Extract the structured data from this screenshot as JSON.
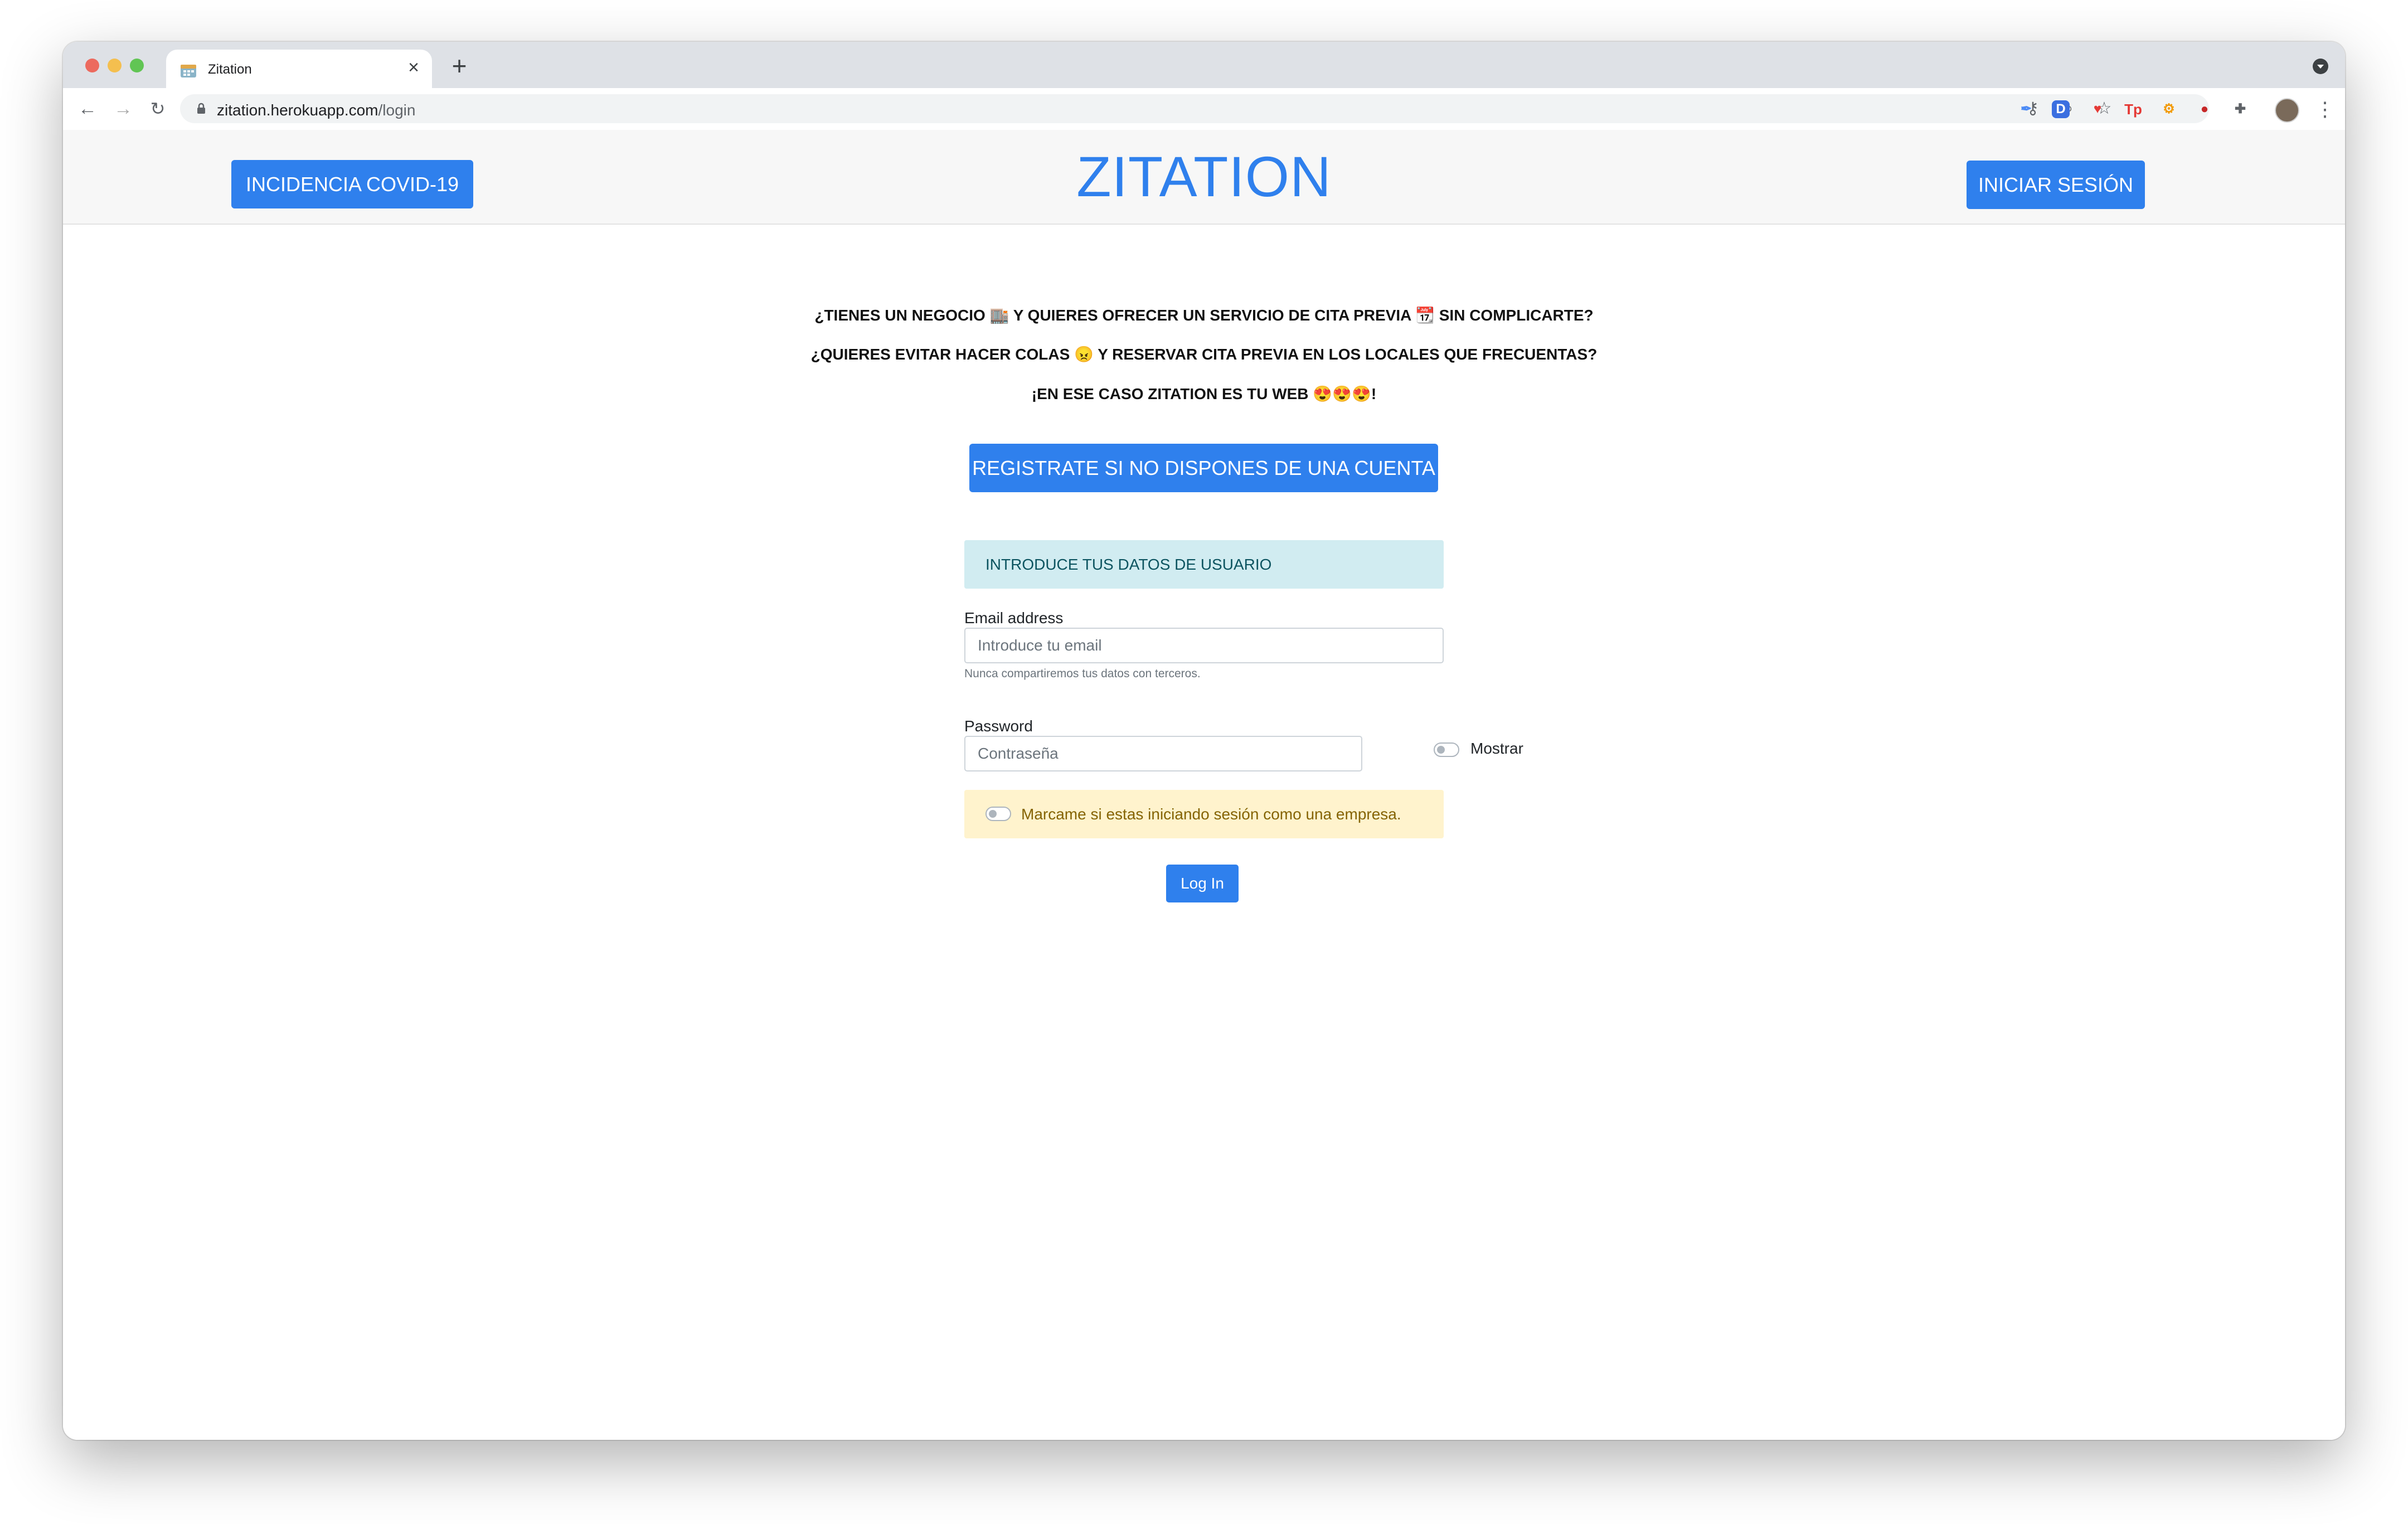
{
  "browser": {
    "tab_title": "Zitation",
    "url_host": "zitation.herokuapp.com",
    "url_path": "/login",
    "extensions": [
      {
        "name": "feather",
        "glyph": "✒",
        "color": "#4c8bf5"
      },
      {
        "name": "D",
        "glyph": "D",
        "color": "#3b6fe0"
      },
      {
        "name": "shield",
        "glyph": "♥",
        "color": "#e53935"
      },
      {
        "name": "Tp",
        "glyph": "Tp",
        "color": "#e53935"
      },
      {
        "name": "orange",
        "glyph": "⚙",
        "color": "#f29900"
      },
      {
        "name": "red-circle",
        "glyph": "●",
        "color": "#c62828"
      }
    ]
  },
  "header": {
    "covid_button": "INCIDENCIA COVID-19",
    "brand": "ZITATION",
    "login_button": "INICIAR SESIÓN"
  },
  "intro": {
    "line1": "¿TIENES UN NEGOCIO 🏬 Y QUIERES OFRECER UN SERVICIO DE CITA PREVIA 📆 SIN COMPLICARTE?",
    "line2": "¿QUIERES EVITAR HACER COLAS 😠 Y RESERVAR CITA PREVIA EN LOS LOCALES QUE FRECUENTAS?",
    "line3": "¡EN ESE CASO ZITATION ES TU WEB 😍😍😍!"
  },
  "register_button": "REGISTRATE SI NO DISPONES DE UNA CUENTA",
  "form": {
    "info": "INTRODUCE TUS DATOS DE USUARIO",
    "email_label": "Email address",
    "email_placeholder": "Introduce tu email",
    "email_help": "Nunca compartiremos tus datos con terceros.",
    "password_label": "Password",
    "password_placeholder": "Contraseña",
    "show_label": "Mostrar",
    "company_label": "Marcame si estas iniciando sesión como una empresa.",
    "submit": "Log In"
  }
}
